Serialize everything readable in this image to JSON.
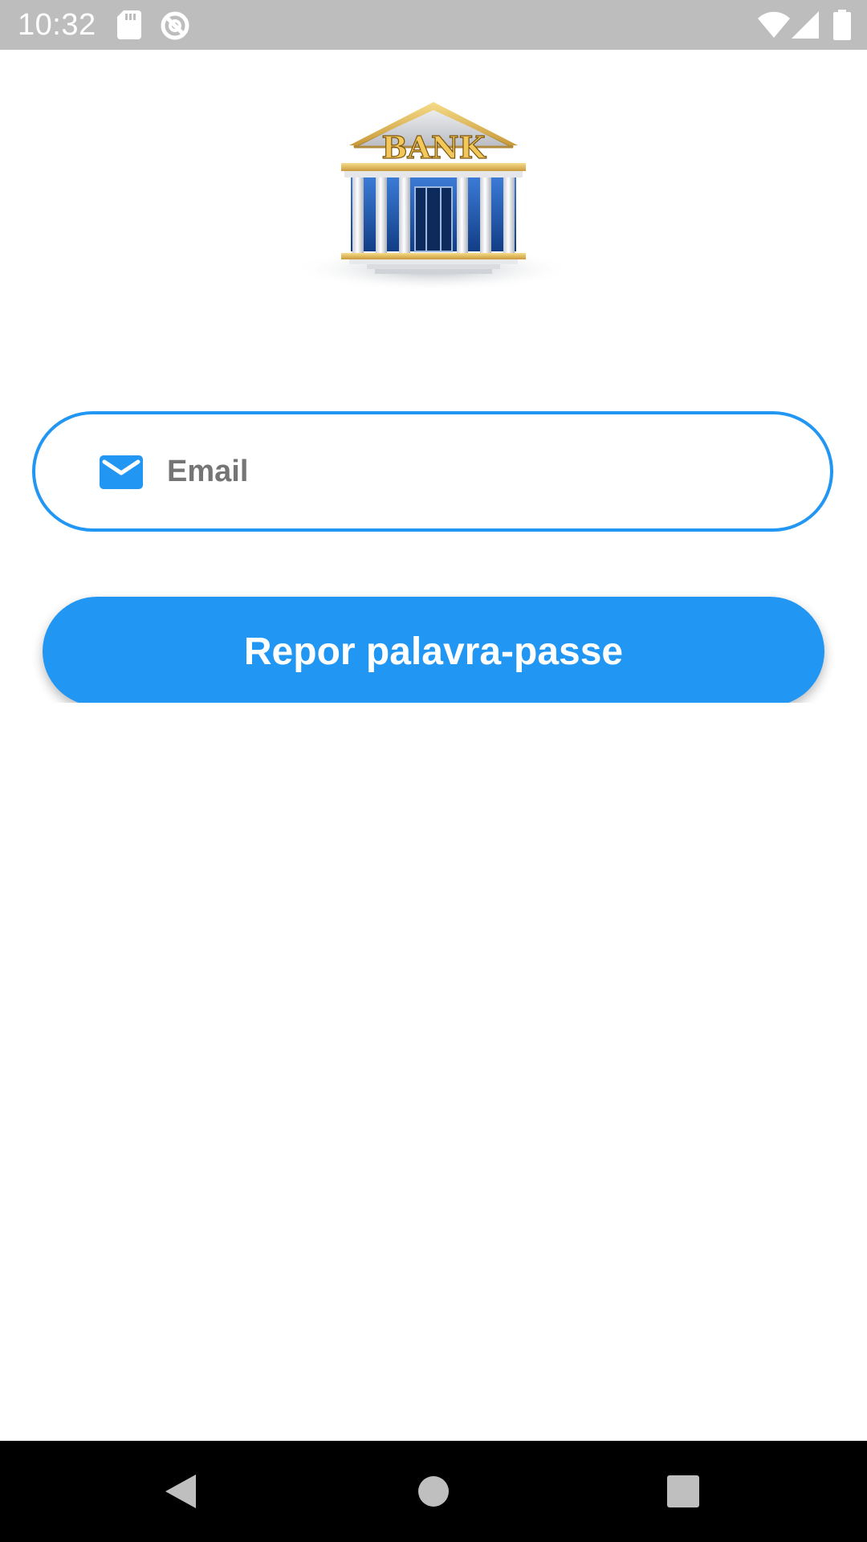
{
  "status_bar": {
    "time": "10:32",
    "left_icons": [
      "sd-card-icon",
      "no-disturb-icon"
    ],
    "right_icons": [
      "wifi-icon",
      "cell-signal-icon",
      "battery-icon"
    ]
  },
  "logo": {
    "sign_text": "BANK"
  },
  "email_field": {
    "placeholder": "Email",
    "value": "",
    "icon": "mail-icon"
  },
  "reset_button": {
    "label": "Repor palavra-passe"
  },
  "nav_bar": {
    "buttons": [
      "back-icon",
      "home-icon",
      "recents-icon"
    ]
  },
  "colors": {
    "accent": "#2196f3",
    "status_bar": "#bdbdbd",
    "nav_bar": "#000000"
  }
}
